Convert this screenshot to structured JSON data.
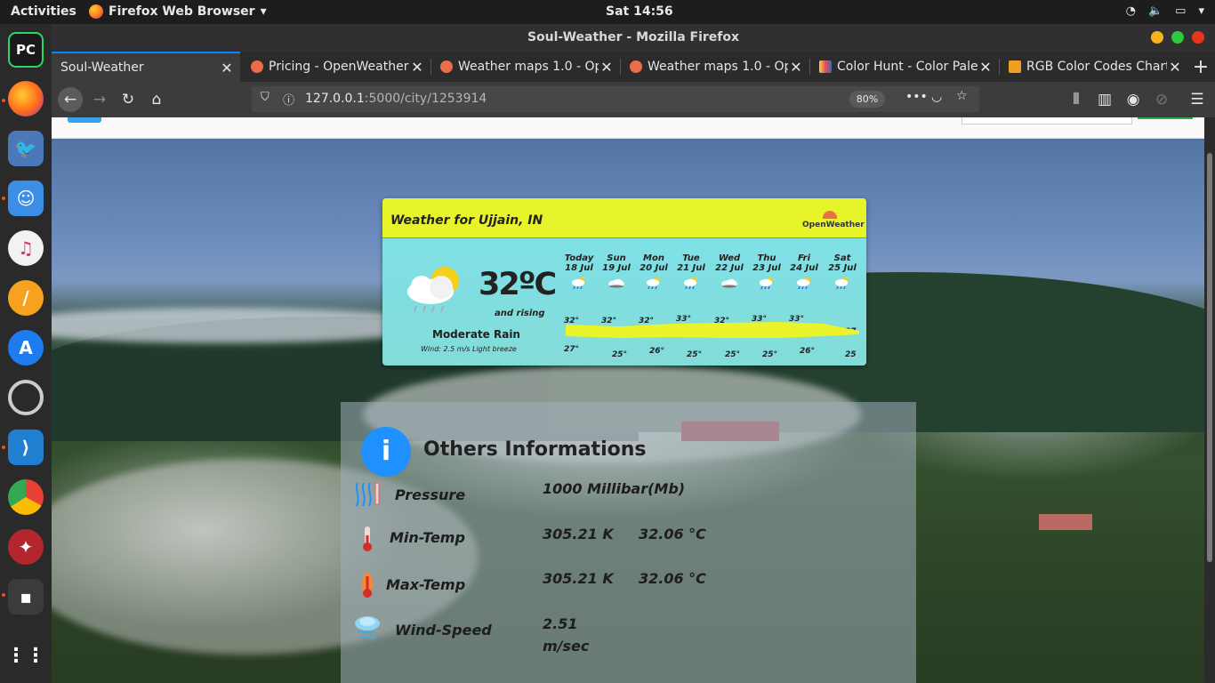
{
  "topbar": {
    "activities": "Activities",
    "app_menu": "Firefox Web Browser",
    "clock": "Sat 14:56"
  },
  "window": {
    "title": "Soul-Weather - Mozilla Firefox"
  },
  "tabs": [
    {
      "label": "Soul-Weather",
      "active": true
    },
    {
      "label": "Pricing - OpenWeather"
    },
    {
      "label": "Weather maps 1.0 - Op"
    },
    {
      "label": "Weather maps 1.0 - Op"
    },
    {
      "label": "Color Hunt - Color Pale"
    },
    {
      "label": "RGB Color Codes Chart"
    }
  ],
  "urlbar": {
    "host": "127.0.0.1",
    "path": ":5000/city/1253914",
    "zoom": "80%"
  },
  "widget": {
    "title": "Weather for Ujjain, IN",
    "logo_text": "OpenWeather",
    "current_temp": "32ºC",
    "trend": "and rising",
    "description": "Moderate Rain",
    "wind": "Wind: 2.5 m/s Light breeze",
    "forecast": [
      {
        "day": "Today",
        "date": "18 Jul",
        "icon": "rain-icon",
        "high": "32°",
        "low": "27°"
      },
      {
        "day": "Sun",
        "date": "19 Jul",
        "icon": "cloud-icon",
        "high": "32°",
        "low": "25°"
      },
      {
        "day": "Mon",
        "date": "20 Jul",
        "icon": "rain-icon",
        "high": "32°",
        "low": "26°"
      },
      {
        "day": "Tue",
        "date": "21 Jul",
        "icon": "rain-icon",
        "high": "33°",
        "low": "25°"
      },
      {
        "day": "Wed",
        "date": "22 Jul",
        "icon": "cloud-icon",
        "high": "32°",
        "low": "25°"
      },
      {
        "day": "Thu",
        "date": "23 Jul",
        "icon": "rain-icon",
        "high": "33°",
        "low": "25°"
      },
      {
        "day": "Fri",
        "date": "24 Jul",
        "icon": "rain-icon",
        "high": "33°",
        "low": "26°"
      },
      {
        "day": "Sat",
        "date": "25 Jul",
        "icon": "rain-icon",
        "high": "27",
        "low": "25"
      }
    ]
  },
  "others": {
    "title": "Others Informations",
    "rows": [
      {
        "label": "Pressure",
        "value1": "1000 Millibar(Mb)",
        "value2": "",
        "icon": "pressure-icon"
      },
      {
        "label": "Min-Temp",
        "value1": "305.21 K",
        "value2": "32.06 °C",
        "icon": "thermometer-low-icon"
      },
      {
        "label": "Max-Temp",
        "value1": "305.21 K",
        "value2": "32.06 °C",
        "icon": "thermometer-high-icon"
      },
      {
        "label": "Wind-Speed",
        "value1": "2.51",
        "value1b": "m/sec",
        "value2": "",
        "icon": "wind-icon"
      }
    ]
  },
  "colors": {
    "widget_header": "#e8f42a",
    "widget_body": "#7fe0e6",
    "info_circle": "#1e90ff",
    "tab_accent": "#0a84ff"
  }
}
